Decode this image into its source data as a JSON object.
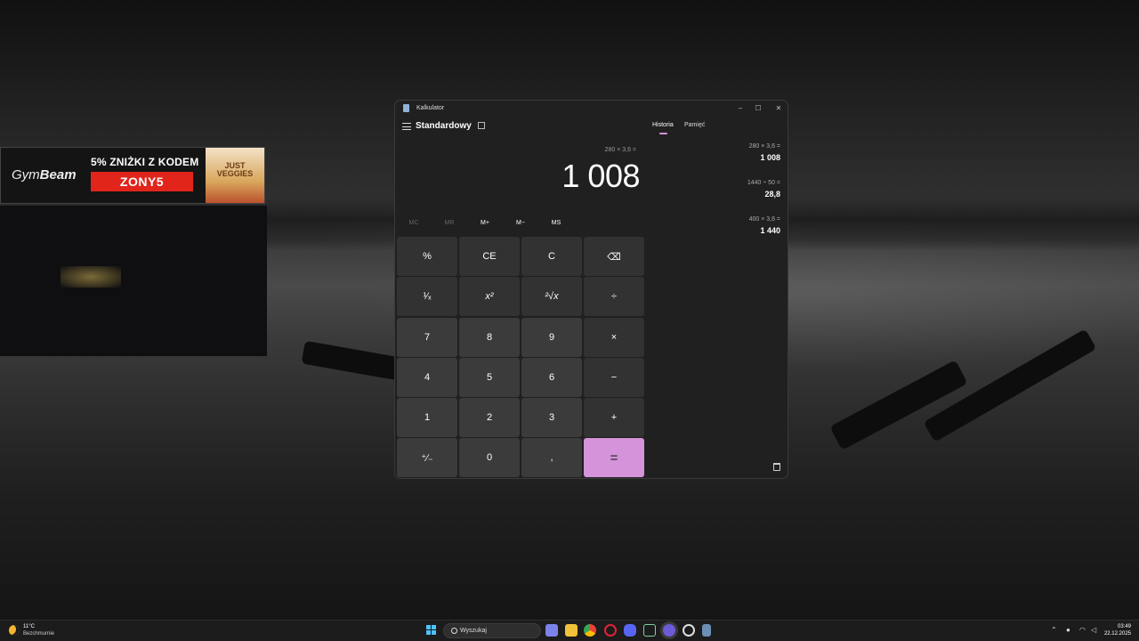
{
  "ad": {
    "brand_light": "Gym",
    "brand_bold": "Beam",
    "promo": "5% ZNIŻKI Z KODEM",
    "code": "ZONY5",
    "product": "JUST VEGGIES"
  },
  "window": {
    "title": "Kalkulator",
    "controls": {
      "minimize": "–",
      "maximize": "☐",
      "close": "✕"
    }
  },
  "calculator": {
    "mode": "Standardowy",
    "tabs": [
      {
        "label": "Historia",
        "active": true
      },
      {
        "label": "Pamięć",
        "active": false
      }
    ],
    "expression": "280 × 3,6 =",
    "display": "1 008",
    "memory": [
      {
        "label": "MC",
        "enabled": false
      },
      {
        "label": "MR",
        "enabled": false
      },
      {
        "label": "M+",
        "enabled": true
      },
      {
        "label": "M−",
        "enabled": true
      },
      {
        "label": "MS",
        "enabled": true
      }
    ],
    "keys": [
      [
        "%",
        "CE",
        "C",
        "⌫"
      ],
      [
        "¹⁄ₓ",
        "x²",
        "²√x",
        "÷"
      ],
      [
        "7",
        "8",
        "9",
        "×"
      ],
      [
        "4",
        "5",
        "6",
        "−"
      ],
      [
        "1",
        "2",
        "3",
        "+"
      ],
      [
        "⁺∕₋",
        "0",
        ",",
        "="
      ]
    ],
    "history": [
      {
        "expression": "280  ×  3,6 =",
        "result": "1 008"
      },
      {
        "expression": "1440  ÷  50 =",
        "result": "28,8"
      },
      {
        "expression": "400  ×  3,6 =",
        "result": "1 440"
      }
    ],
    "accent_color": "#d593d9"
  },
  "taskbar": {
    "weather_temp": "11°C",
    "weather_desc": "Bezchmurnie",
    "search_placeholder": "Wyszukaj",
    "time": "03:49",
    "date": "22.12.2025",
    "apps": [
      "teams-icon",
      "file-explorer-icon",
      "chrome-icon",
      "opera-icon",
      "discord-icon",
      "xbox-icon",
      "app-icon",
      "chrome-alt-icon",
      "calculator-icon"
    ]
  }
}
